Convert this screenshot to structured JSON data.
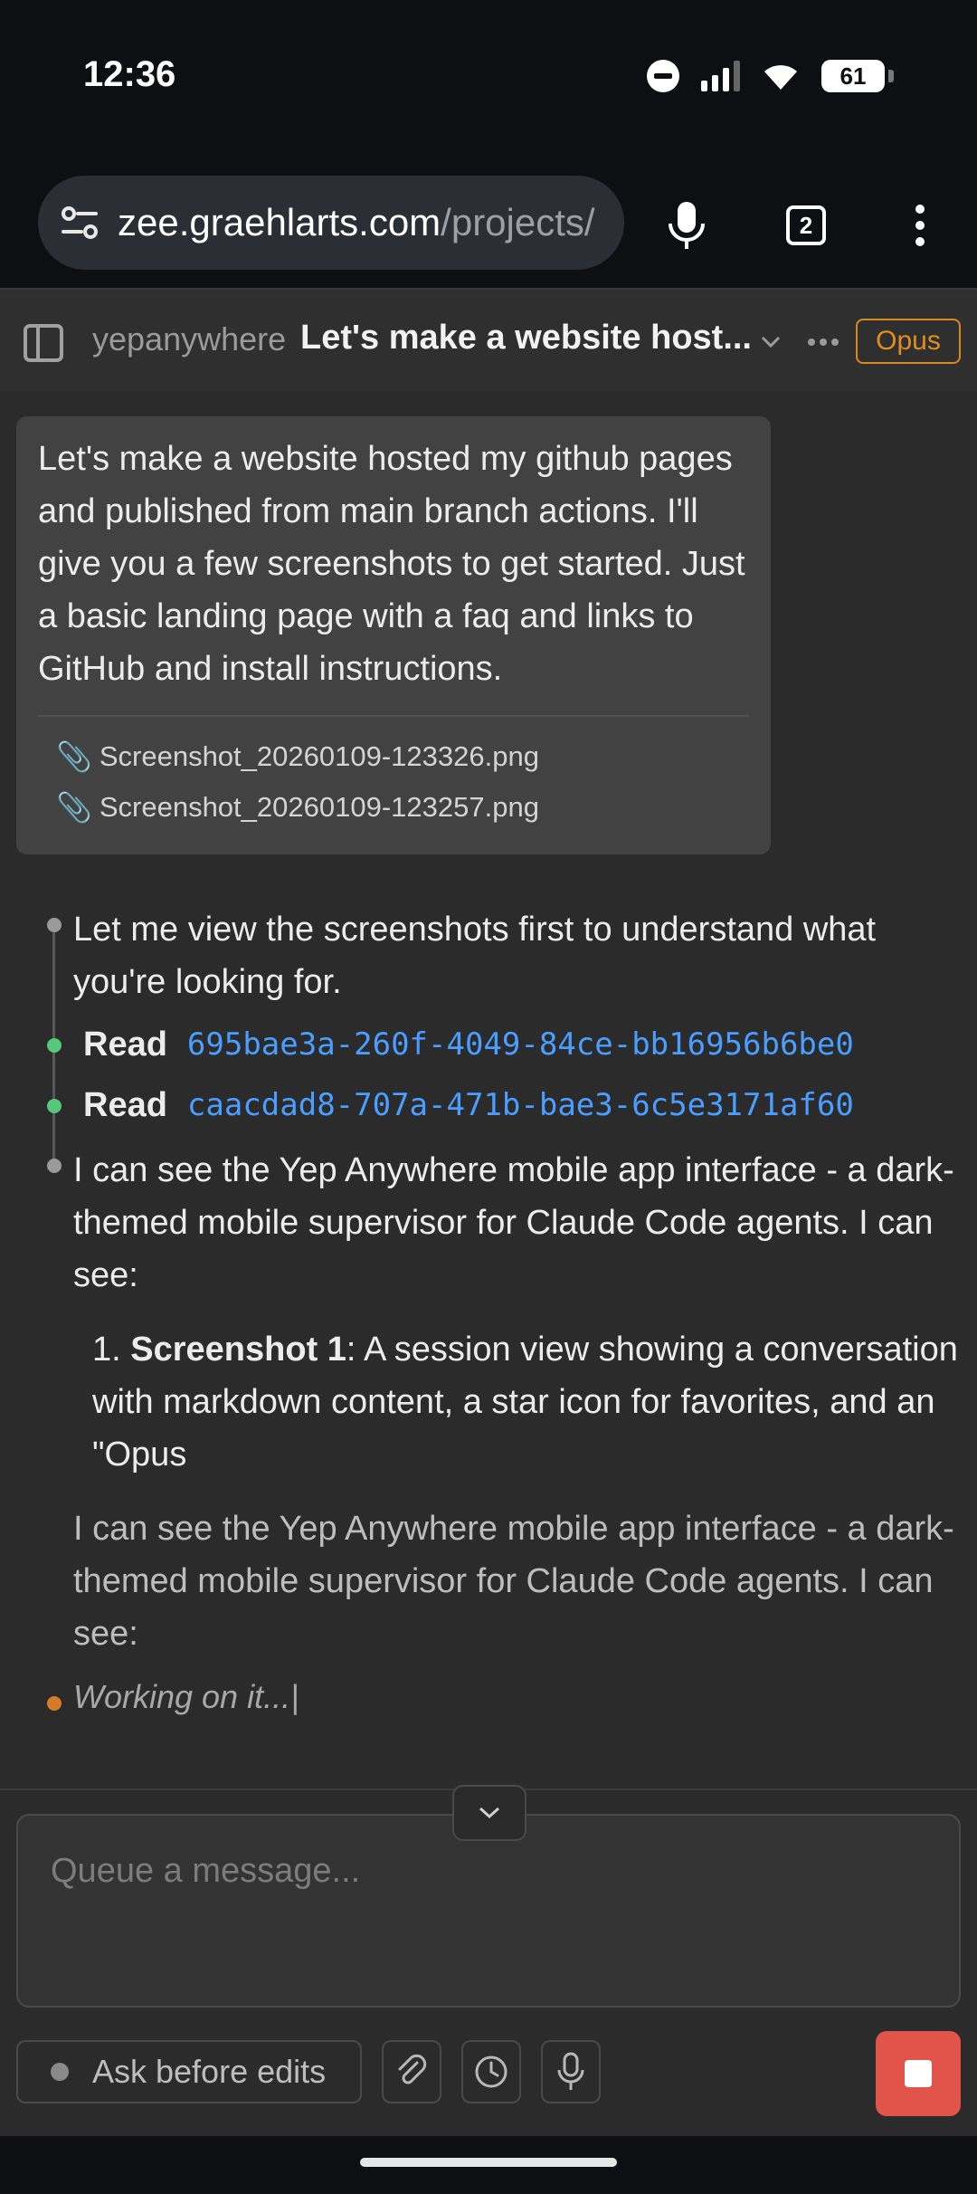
{
  "status_bar": {
    "time": "12:36",
    "battery": "61",
    "battery_fraction": 0.61
  },
  "browser": {
    "url_host": "zee.graehlarts.com",
    "url_path": "/projects/",
    "tab_count": "2"
  },
  "header": {
    "project": "yepanywhere",
    "title": "Let's make a website host...",
    "model": "Opus"
  },
  "user_message": {
    "text": "Let's make a website hosted my github pages and published from main branch actions. I'll give you a few screenshots to get started. Just a basic landing page with a faq and links to GitHub and install instructions.",
    "attachments": [
      "Screenshot_20260109-123326.png",
      "Screenshot_20260109-123257.png"
    ]
  },
  "assistant": {
    "intro": "Let me view the screenshots first to understand what you're looking for.",
    "tool_calls": [
      {
        "name": "Read",
        "arg": "695bae3a-260f-4049-84ce-bb16956b6be0"
      },
      {
        "name": "Read",
        "arg": "caacdad8-707a-471b-bae3-6c5e3171af60"
      }
    ],
    "summary": "I can see the Yep Anywhere mobile app interface - a dark-themed mobile supervisor for Claude Code agents. I can see:",
    "list_item_1": {
      "number": "1.",
      "bold": "Screenshot 1",
      "text": ": A session view showing a conversation with markdown content, a star icon for favorites, and an \"Opus"
    },
    "streaming_text": "I can see the Yep Anywhere mobile app interface - a dark-themed mobile supervisor for Claude Code agents. I can see:",
    "working": "Working on it...|"
  },
  "composer": {
    "placeholder": "Queue a message..."
  },
  "toolbar": {
    "mode_label": "Ask before edits"
  },
  "colors": {
    "accent_orange": "#e08d1e",
    "link_blue": "#4a9eff",
    "success_green": "#55c97b",
    "stop_red": "#e0544a"
  },
  "icons": [
    "sidebar-toggle-icon",
    "chevron-down-icon",
    "more-icon",
    "paperclip-icon",
    "clock-icon",
    "microphone-icon",
    "stop-icon"
  ]
}
